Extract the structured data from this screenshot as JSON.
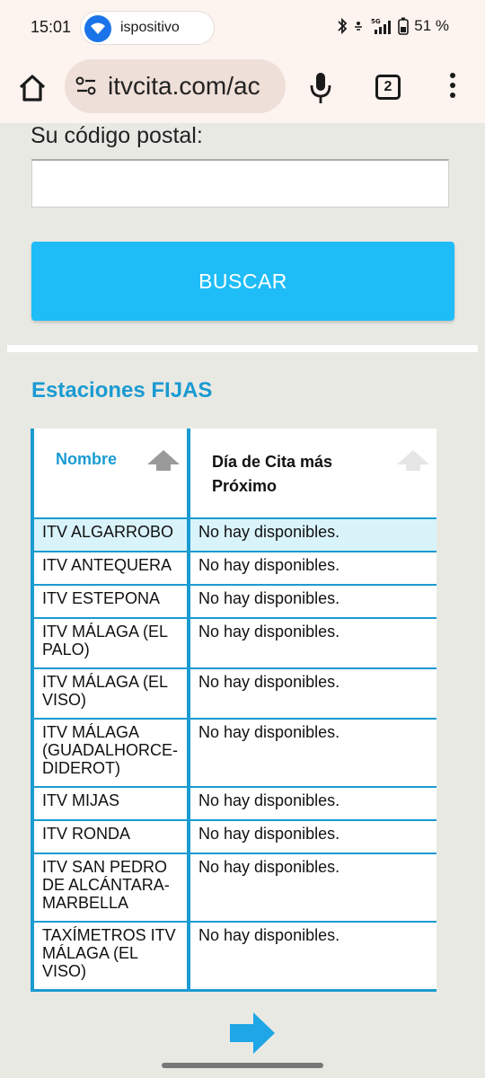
{
  "status_bar": {
    "time": "15:01",
    "notification_text": "ispositivo",
    "battery": "51 %",
    "network": "5G"
  },
  "browser": {
    "url": "itvcita.com/ac",
    "tab_count": "2"
  },
  "form": {
    "postal_label": "Su código postal:",
    "postal_value": "",
    "search_label": "BUSCAR"
  },
  "stations": {
    "title": "Estaciones FIJAS",
    "columns": [
      "Nombre",
      "Día de Cita más Próximo"
    ],
    "rows": [
      {
        "name": "ITV ALGARROBO",
        "date": "No hay disponibles."
      },
      {
        "name": "ITV ANTEQUERA",
        "date": "No hay disponibles."
      },
      {
        "name": "ITV ESTEPONA",
        "date": "No hay disponibles."
      },
      {
        "name": "ITV MÁLAGA (EL PALO)",
        "date": "No hay disponibles."
      },
      {
        "name": "ITV MÁLAGA (EL VISO)",
        "date": "No hay disponibles."
      },
      {
        "name": "ITV MÁLAGA (GUADALHORCE-DIDEROT)",
        "date": "No hay disponibles."
      },
      {
        "name": "ITV MIJAS",
        "date": "No hay disponibles."
      },
      {
        "name": "ITV RONDA",
        "date": "No hay disponibles."
      },
      {
        "name": "ITV SAN PEDRO DE ALCÁNTARA-MARBELLA",
        "date": "No hay disponibles."
      },
      {
        "name": "TAXÍMETROS ITV MÁLAGA (EL VISO)",
        "date": "No hay disponibles."
      }
    ]
  },
  "colors": {
    "accent": "#1a9bd1",
    "button": "#1fbdf8",
    "highlight_row": "#d9f3fb"
  }
}
